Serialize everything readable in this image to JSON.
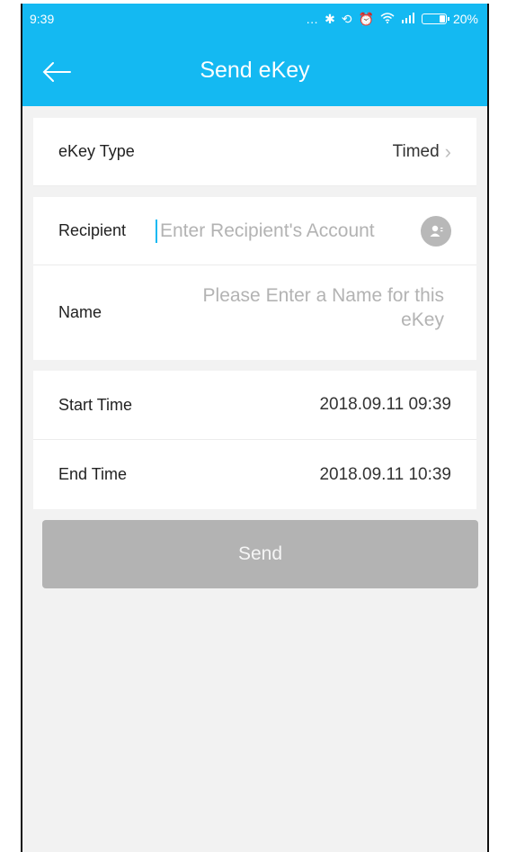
{
  "status_bar": {
    "time": "9:39",
    "icons": [
      "more-icon",
      "bluetooth-icon",
      "rotation-lock-icon",
      "alarm-icon",
      "wifi-icon",
      "signal-icon",
      "battery-icon"
    ],
    "battery_text": "20%"
  },
  "header": {
    "title": "Send eKey",
    "back_icon": "arrow-left-icon",
    "background_color": "#14b9f2"
  },
  "form": {
    "ekey_type": {
      "label": "eKey Type",
      "value": "Timed"
    },
    "recipient": {
      "label": "Recipient",
      "placeholder": "Enter Recipient's Account",
      "value": ""
    },
    "name": {
      "label": "Name",
      "placeholder": "Please Enter a Name for this eKey",
      "value": ""
    },
    "start_time": {
      "label": "Start Time",
      "value": "2018.09.11 09:39"
    },
    "end_time": {
      "label": "End Time",
      "value": "2018.09.11 10:39"
    }
  },
  "send_button": {
    "label": "Send",
    "color": "#b3b3b3"
  }
}
